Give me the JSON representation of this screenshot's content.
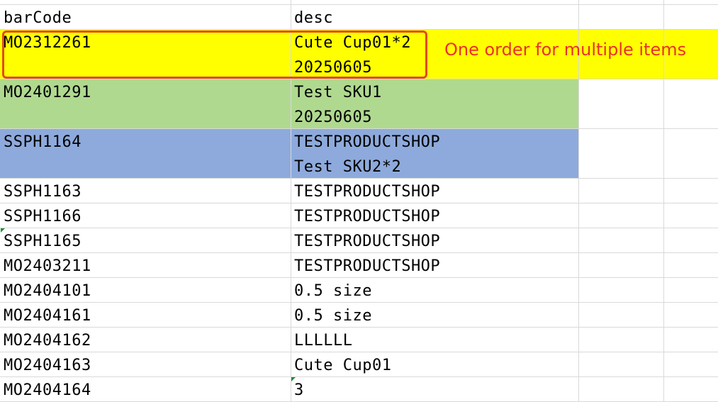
{
  "headers": {
    "col_a": "barCode",
    "col_b": "desc"
  },
  "rows": [
    {
      "barCode": "MO2312261",
      "desc_line1": "Cute Cup01*2",
      "desc_line2": "20250605"
    },
    {
      "barCode": "MO2401291",
      "desc_line1": "Test SKU1",
      "desc_line2": "20250605"
    },
    {
      "barCode": "SSPH1164",
      "desc_line1": "TESTPRODUCTSHOP",
      "desc_line2": "Test SKU2*2"
    },
    {
      "barCode": "SSPH1163",
      "desc": "TESTPRODUCTSHOP"
    },
    {
      "barCode": "SSPH1166",
      "desc": "TESTPRODUCTSHOP"
    },
    {
      "barCode": "SSPH1165",
      "desc": "TESTPRODUCTSHOP"
    },
    {
      "barCode": "MO2403211",
      "desc": "TESTPRODUCTSHOP"
    },
    {
      "barCode": "MO2404101",
      "desc": "0.5 size"
    },
    {
      "barCode": "MO2404161",
      "desc": "0.5 size"
    },
    {
      "barCode": "MO2404162",
      "desc": "LLLLLL"
    },
    {
      "barCode": "MO2404163",
      "desc": "Cute Cup01"
    },
    {
      "barCode": "MO2404164",
      "desc": "3"
    }
  ],
  "annotation": {
    "text": "One order for multiple items",
    "color": "#e8312a"
  },
  "colors": {
    "yellow_highlight": "#ffff00",
    "green_highlight": "#b0d990",
    "blue_highlight": "#8eaadc",
    "gridline": "#d9d9d9",
    "annotation_border": "#e24a1f"
  }
}
